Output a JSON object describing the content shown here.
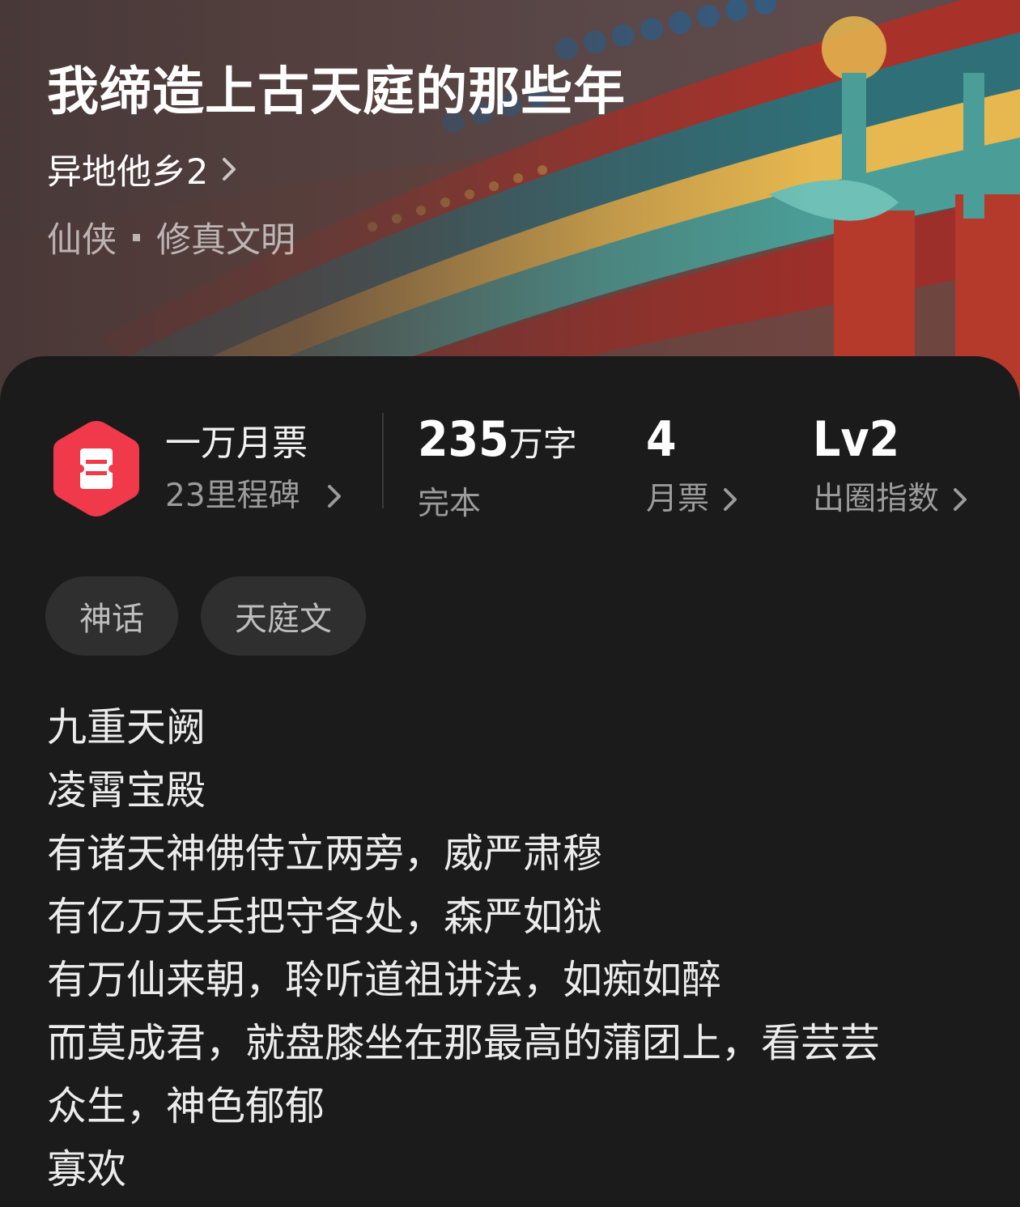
{
  "book": {
    "title": "我缔造上古天庭的那些年",
    "author": "异地他乡2",
    "genre_primary": "仙侠",
    "genre_secondary": "修真文明"
  },
  "stats": {
    "monthly_ticket_title": "一万月票",
    "milestones": "23里程碑",
    "word_count_number": "235",
    "word_count_unit": "万字",
    "status": "完本",
    "votes_value": "4",
    "votes_label": "月票",
    "level_value": "Lv2",
    "level_label": "出圈指数"
  },
  "tags": [
    "神话",
    "天庭文"
  ],
  "synopsis": [
    "九重天阙",
    "凌霄宝殿",
    "有诸天神佛侍立两旁，威严肃穆",
    "有亿万天兵把守各处，森严如狱",
    "有万仙来朝，聆听道祖讲法，如痴如醉",
    "而莫成君，就盘膝坐在那最高的蒲团上，看芸芸",
    "众生，神色郁郁",
    "寡欢"
  ],
  "colors": {
    "background": "#1b1b1b",
    "tag_background": "#2f2f2f",
    "ticket_icon": "#f0394a",
    "muted_text": "#9b9b9b"
  },
  "icons": {
    "author_chevron": "chevron-right-icon",
    "ticket": "monthly-ticket-icon"
  }
}
